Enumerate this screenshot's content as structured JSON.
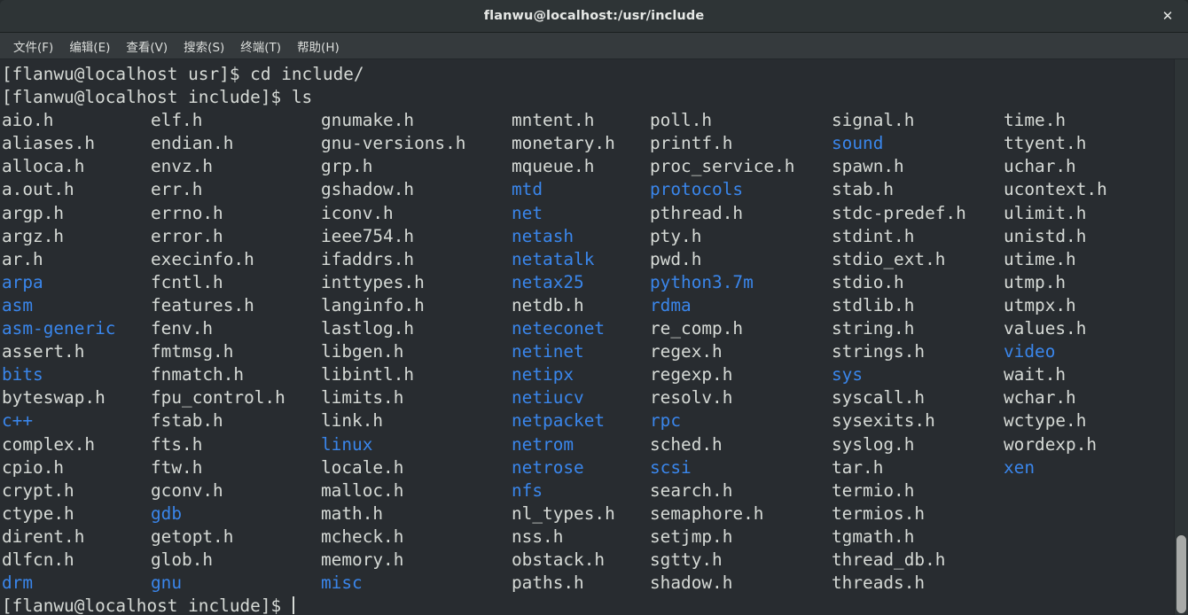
{
  "window": {
    "title": "flanwu@localhost:/usr/include",
    "close_label": "✕"
  },
  "menubar": {
    "items": [
      {
        "label": "文件(F)",
        "name": "file"
      },
      {
        "label": "编辑(E)",
        "name": "edit"
      },
      {
        "label": "查看(V)",
        "name": "view"
      },
      {
        "label": "搜索(S)",
        "name": "search"
      },
      {
        "label": "终端(T)",
        "name": "terminal"
      },
      {
        "label": "帮助(H)",
        "name": "help"
      }
    ]
  },
  "terminal": {
    "colors": {
      "background": "#282c30",
      "foreground": "#d6dad6",
      "directory": "#3a86eb",
      "titlebar": "#2e3436",
      "menubar": "#353a3d"
    },
    "history": [
      "[flanwu@localhost usr]$ cd include/",
      "[flanwu@localhost include]$ ls"
    ],
    "prompt": "[flanwu@localhost include]$ ",
    "ls_columns": [
      [
        {
          "name": "aio.h",
          "type": "file"
        },
        {
          "name": "aliases.h",
          "type": "file"
        },
        {
          "name": "alloca.h",
          "type": "file"
        },
        {
          "name": "a.out.h",
          "type": "file"
        },
        {
          "name": "argp.h",
          "type": "file"
        },
        {
          "name": "argz.h",
          "type": "file"
        },
        {
          "name": "ar.h",
          "type": "file"
        },
        {
          "name": "arpa",
          "type": "dir"
        },
        {
          "name": "asm",
          "type": "dir"
        },
        {
          "name": "asm-generic",
          "type": "dir"
        },
        {
          "name": "assert.h",
          "type": "file"
        },
        {
          "name": "bits",
          "type": "dir"
        },
        {
          "name": "byteswap.h",
          "type": "file"
        },
        {
          "name": "c++",
          "type": "dir"
        },
        {
          "name": "complex.h",
          "type": "file"
        },
        {
          "name": "cpio.h",
          "type": "file"
        },
        {
          "name": "crypt.h",
          "type": "file"
        },
        {
          "name": "ctype.h",
          "type": "file"
        },
        {
          "name": "dirent.h",
          "type": "file"
        },
        {
          "name": "dlfcn.h",
          "type": "file"
        },
        {
          "name": "drm",
          "type": "dir"
        }
      ],
      [
        {
          "name": "elf.h",
          "type": "file"
        },
        {
          "name": "endian.h",
          "type": "file"
        },
        {
          "name": "envz.h",
          "type": "file"
        },
        {
          "name": "err.h",
          "type": "file"
        },
        {
          "name": "errno.h",
          "type": "file"
        },
        {
          "name": "error.h",
          "type": "file"
        },
        {
          "name": "execinfo.h",
          "type": "file"
        },
        {
          "name": "fcntl.h",
          "type": "file"
        },
        {
          "name": "features.h",
          "type": "file"
        },
        {
          "name": "fenv.h",
          "type": "file"
        },
        {
          "name": "fmtmsg.h",
          "type": "file"
        },
        {
          "name": "fnmatch.h",
          "type": "file"
        },
        {
          "name": "fpu_control.h",
          "type": "file"
        },
        {
          "name": "fstab.h",
          "type": "file"
        },
        {
          "name": "fts.h",
          "type": "file"
        },
        {
          "name": "ftw.h",
          "type": "file"
        },
        {
          "name": "gconv.h",
          "type": "file"
        },
        {
          "name": "gdb",
          "type": "dir"
        },
        {
          "name": "getopt.h",
          "type": "file"
        },
        {
          "name": "glob.h",
          "type": "file"
        },
        {
          "name": "gnu",
          "type": "dir"
        }
      ],
      [
        {
          "name": "gnumake.h",
          "type": "file"
        },
        {
          "name": "gnu-versions.h",
          "type": "file"
        },
        {
          "name": "grp.h",
          "type": "file"
        },
        {
          "name": "gshadow.h",
          "type": "file"
        },
        {
          "name": "iconv.h",
          "type": "file"
        },
        {
          "name": "ieee754.h",
          "type": "file"
        },
        {
          "name": "ifaddrs.h",
          "type": "file"
        },
        {
          "name": "inttypes.h",
          "type": "file"
        },
        {
          "name": "langinfo.h",
          "type": "file"
        },
        {
          "name": "lastlog.h",
          "type": "file"
        },
        {
          "name": "libgen.h",
          "type": "file"
        },
        {
          "name": "libintl.h",
          "type": "file"
        },
        {
          "name": "limits.h",
          "type": "file"
        },
        {
          "name": "link.h",
          "type": "file"
        },
        {
          "name": "linux",
          "type": "dir"
        },
        {
          "name": "locale.h",
          "type": "file"
        },
        {
          "name": "malloc.h",
          "type": "file"
        },
        {
          "name": "math.h",
          "type": "file"
        },
        {
          "name": "mcheck.h",
          "type": "file"
        },
        {
          "name": "memory.h",
          "type": "file"
        },
        {
          "name": "misc",
          "type": "dir"
        }
      ],
      [
        {
          "name": "mntent.h",
          "type": "file"
        },
        {
          "name": "monetary.h",
          "type": "file"
        },
        {
          "name": "mqueue.h",
          "type": "file"
        },
        {
          "name": "mtd",
          "type": "dir"
        },
        {
          "name": "net",
          "type": "dir"
        },
        {
          "name": "netash",
          "type": "dir"
        },
        {
          "name": "netatalk",
          "type": "dir"
        },
        {
          "name": "netax25",
          "type": "dir"
        },
        {
          "name": "netdb.h",
          "type": "file"
        },
        {
          "name": "neteconet",
          "type": "dir"
        },
        {
          "name": "netinet",
          "type": "dir"
        },
        {
          "name": "netipx",
          "type": "dir"
        },
        {
          "name": "netiucv",
          "type": "dir"
        },
        {
          "name": "netpacket",
          "type": "dir"
        },
        {
          "name": "netrom",
          "type": "dir"
        },
        {
          "name": "netrose",
          "type": "dir"
        },
        {
          "name": "nfs",
          "type": "dir"
        },
        {
          "name": "nl_types.h",
          "type": "file"
        },
        {
          "name": "nss.h",
          "type": "file"
        },
        {
          "name": "obstack.h",
          "type": "file"
        },
        {
          "name": "paths.h",
          "type": "file"
        }
      ],
      [
        {
          "name": "poll.h",
          "type": "file"
        },
        {
          "name": "printf.h",
          "type": "file"
        },
        {
          "name": "proc_service.h",
          "type": "file"
        },
        {
          "name": "protocols",
          "type": "dir"
        },
        {
          "name": "pthread.h",
          "type": "file"
        },
        {
          "name": "pty.h",
          "type": "file"
        },
        {
          "name": "pwd.h",
          "type": "file"
        },
        {
          "name": "python3.7m",
          "type": "dir"
        },
        {
          "name": "rdma",
          "type": "dir"
        },
        {
          "name": "re_comp.h",
          "type": "file"
        },
        {
          "name": "regex.h",
          "type": "file"
        },
        {
          "name": "regexp.h",
          "type": "file"
        },
        {
          "name": "resolv.h",
          "type": "file"
        },
        {
          "name": "rpc",
          "type": "dir"
        },
        {
          "name": "sched.h",
          "type": "file"
        },
        {
          "name": "scsi",
          "type": "dir"
        },
        {
          "name": "search.h",
          "type": "file"
        },
        {
          "name": "semaphore.h",
          "type": "file"
        },
        {
          "name": "setjmp.h",
          "type": "file"
        },
        {
          "name": "sgtty.h",
          "type": "file"
        },
        {
          "name": "shadow.h",
          "type": "file"
        }
      ],
      [
        {
          "name": "signal.h",
          "type": "file"
        },
        {
          "name": "sound",
          "type": "dir"
        },
        {
          "name": "spawn.h",
          "type": "file"
        },
        {
          "name": "stab.h",
          "type": "file"
        },
        {
          "name": "stdc-predef.h",
          "type": "file"
        },
        {
          "name": "stdint.h",
          "type": "file"
        },
        {
          "name": "stdio_ext.h",
          "type": "file"
        },
        {
          "name": "stdio.h",
          "type": "file"
        },
        {
          "name": "stdlib.h",
          "type": "file"
        },
        {
          "name": "string.h",
          "type": "file"
        },
        {
          "name": "strings.h",
          "type": "file"
        },
        {
          "name": "sys",
          "type": "dir"
        },
        {
          "name": "syscall.h",
          "type": "file"
        },
        {
          "name": "sysexits.h",
          "type": "file"
        },
        {
          "name": "syslog.h",
          "type": "file"
        },
        {
          "name": "tar.h",
          "type": "file"
        },
        {
          "name": "termio.h",
          "type": "file"
        },
        {
          "name": "termios.h",
          "type": "file"
        },
        {
          "name": "tgmath.h",
          "type": "file"
        },
        {
          "name": "thread_db.h",
          "type": "file"
        },
        {
          "name": "threads.h",
          "type": "file"
        }
      ],
      [
        {
          "name": "time.h",
          "type": "file"
        },
        {
          "name": "ttyent.h",
          "type": "file"
        },
        {
          "name": "uchar.h",
          "type": "file"
        },
        {
          "name": "ucontext.h",
          "type": "file"
        },
        {
          "name": "ulimit.h",
          "type": "file"
        },
        {
          "name": "unistd.h",
          "type": "file"
        },
        {
          "name": "utime.h",
          "type": "file"
        },
        {
          "name": "utmp.h",
          "type": "file"
        },
        {
          "name": "utmpx.h",
          "type": "file"
        },
        {
          "name": "values.h",
          "type": "file"
        },
        {
          "name": "video",
          "type": "dir"
        },
        {
          "name": "wait.h",
          "type": "file"
        },
        {
          "name": "wchar.h",
          "type": "file"
        },
        {
          "name": "wctype.h",
          "type": "file"
        },
        {
          "name": "wordexp.h",
          "type": "file"
        },
        {
          "name": "xen",
          "type": "dir"
        }
      ]
    ]
  }
}
